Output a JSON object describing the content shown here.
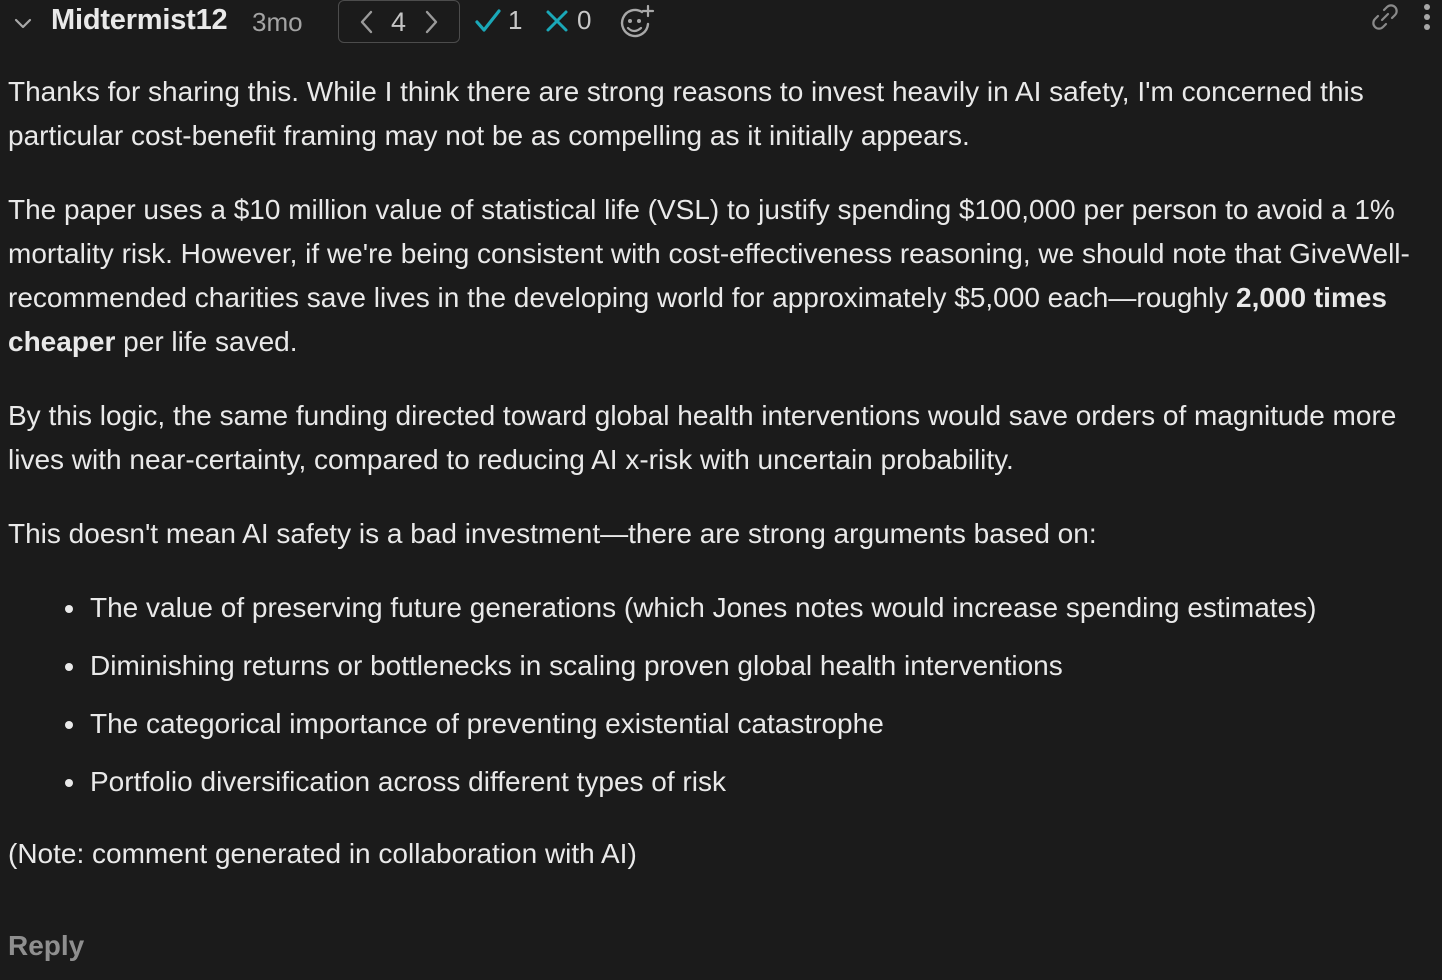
{
  "comment": {
    "author": "Midtermist12",
    "age": "3mo",
    "karma": "4",
    "agree_count": "1",
    "disagree_count": "0",
    "colors": {
      "background": "#1b1b1b",
      "text": "#e9e9e9",
      "muted": "#a3a3a3",
      "accent_teal": "#1aa8b8"
    },
    "icons": {
      "collapse": "chevron-down-icon",
      "karma_down": "chevron-left-icon",
      "karma_up": "chevron-right-icon",
      "agree": "check-icon",
      "disagree": "x-icon",
      "react": "add-reaction-icon",
      "link": "link-icon",
      "menu": "vertical-dots-icon"
    },
    "body": {
      "p1": "Thanks for sharing this. While I think there are strong reasons to invest heavily in AI safety, I'm concerned this particular cost-benefit framing may not be as compelling as it initially appears.",
      "p2_before": "The paper uses a $10 million value of statistical life (VSL) to justify spending $100,000 per person to avoid a 1% mortality risk. However, if we're being consistent with cost-effectiveness reasoning, we should note that GiveWell-recommended charities save lives in the developing world for approximately $5,000 each—roughly ",
      "p2_bold": "2,000 times cheaper",
      "p2_after": " per life saved.",
      "p3": "By this logic, the same funding directed toward global health interventions would save orders of magnitude more lives with near-certainty, compared to reducing AI x-risk with uncertain probability.",
      "p4": "This doesn't mean AI safety is a bad investment—there are strong arguments based on:",
      "bullets": [
        "The value of preserving future generations (which Jones notes would increase spending estimates)",
        "Diminishing returns or bottlenecks in scaling proven global health interventions",
        "The categorical importance of preventing existential catastrophe",
        "Portfolio diversification across different types of risk"
      ],
      "note": "(Note: comment generated in collaboration with AI)"
    },
    "reply_label": "Reply"
  }
}
